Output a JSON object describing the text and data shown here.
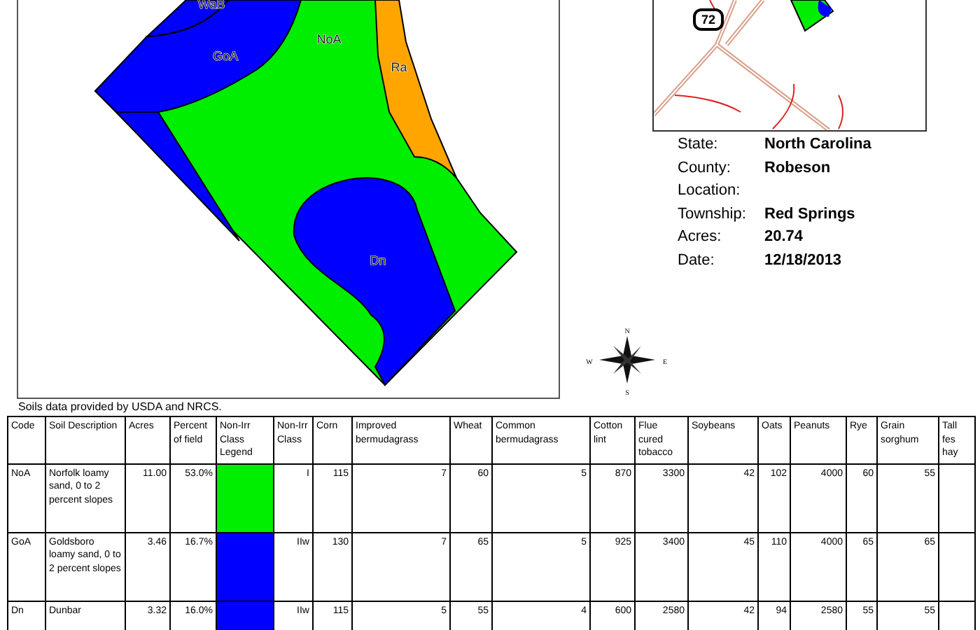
{
  "soil_map": {
    "units": [
      {
        "label": "WaB",
        "color": "#0000ff"
      },
      {
        "label": "GoA",
        "color": "#0000ff"
      },
      {
        "label": "NoA",
        "color": "#00ee00"
      },
      {
        "label": "Ra",
        "color": "#ffa500"
      },
      {
        "label": "Dn",
        "color": "#0000ff"
      }
    ]
  },
  "locator_map": {
    "route_shield": "72"
  },
  "field_info": [
    {
      "label": "State:",
      "value": "North Carolina"
    },
    {
      "label": "County:",
      "value": "Robeson"
    },
    {
      "label": "Location:"
    },
    {
      "label": "Township:",
      "value": "Red Springs"
    },
    {
      "label": "Acres:",
      "value": "20.74"
    },
    {
      "label": "Date:",
      "value": "12/18/2013"
    }
  ],
  "compass": {
    "n": "N",
    "s": "S",
    "e": "E",
    "w": "W"
  },
  "source_note": "Soils data provided by USDA and NRCS.",
  "table": {
    "columns": [
      "Code",
      "Soil Description",
      "Acres",
      "Percent of field",
      "Non-Irr Class Legend",
      "Non-Irr Class",
      "Corn",
      "Improved bermudagrass",
      "Wheat",
      "Common bermudagrass",
      "Cotton lint",
      "Flue cured tobacco",
      "Soybeans",
      "Oats",
      "Peanuts",
      "Rye",
      "Grain sorghum",
      "Tall fes hay"
    ],
    "rows": [
      {
        "code": "NoA",
        "description": "Norfolk loamy sand, 0 to 2 percent slopes",
        "acres": "11.00",
        "percent": "53.0%",
        "color": "#00ee00",
        "class": "I",
        "yields": [
          "115",
          "7",
          "60",
          "5",
          "870",
          "3300",
          "42",
          "102",
          "4000",
          "60",
          "55"
        ]
      },
      {
        "code": "GoA",
        "description": "Goldsboro loamy sand, 0 to 2 percent slopes",
        "acres": "3.46",
        "percent": "16.7%",
        "color": "#0000ff",
        "class": "IIw",
        "yields": [
          "130",
          "7",
          "65",
          "5",
          "925",
          "3400",
          "45",
          "110",
          "4000",
          "65",
          "65"
        ]
      },
      {
        "code": "Dn",
        "description": "Dunbar",
        "acres": "3.32",
        "percent": "16.0%",
        "color": "#0000ff",
        "class": "IIw",
        "yields": [
          "115",
          "5",
          "55",
          "4",
          "600",
          "2580",
          "42",
          "94",
          "2580",
          "55",
          "55"
        ]
      }
    ]
  }
}
